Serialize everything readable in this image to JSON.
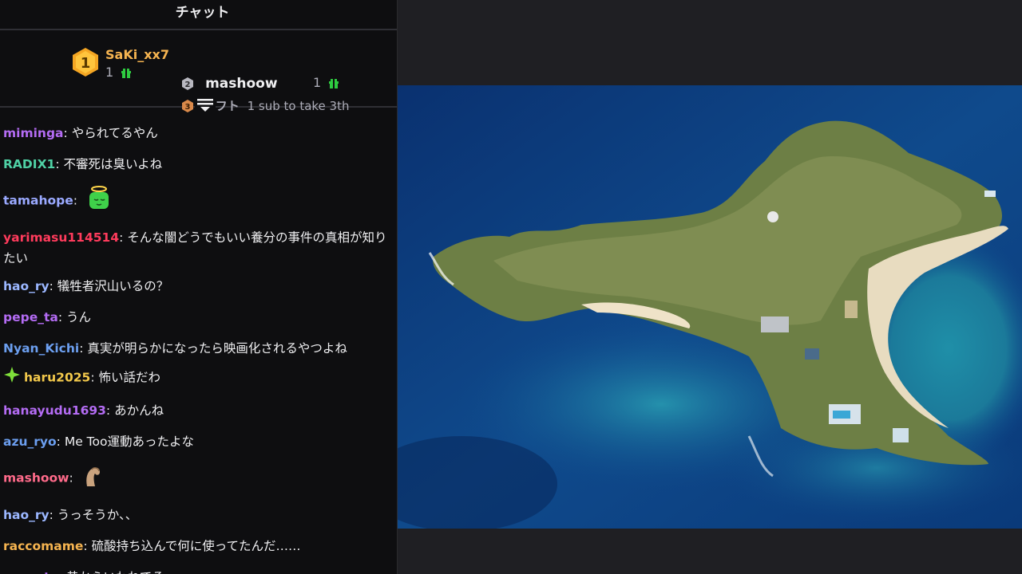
{
  "chat": {
    "title": "チャット",
    "leaderboard": {
      "first": {
        "rank": "1",
        "name": "SaKi_xx7",
        "count": "1"
      },
      "second": {
        "rank": "2",
        "name": "mashoow",
        "count": "1"
      },
      "third": {
        "rank": "3",
        "gift_label": "ギフト",
        "text": "1 sub to take 3th"
      }
    },
    "messages": [
      {
        "user": "miminga",
        "color": "#b46cf4",
        "text": "やられてるやん"
      },
      {
        "user": "RADIX1",
        "color": "#4fd1a5",
        "text": "不審死は臭いよね"
      },
      {
        "user": "tamahope",
        "color": "#9aa9ff",
        "text": "",
        "emote": "halo-face-emote"
      },
      {
        "user": "yarimasu114514",
        "color": "#ff3b5c",
        "text": "そんな闇どうでもいい養分の事件の真相が知りたい"
      },
      {
        "user": "hao_ry",
        "color": "#9bb7ff",
        "text": "犠牲者沢山いるの？"
      },
      {
        "user": "pepe_ta",
        "color": "#b46cf4",
        "text": "うん"
      },
      {
        "user": "Nyan_Kichi",
        "color": "#6c9ff0",
        "text": "真実が明らかになったら映画化されるやつよね"
      },
      {
        "user": "haru2025",
        "color": "#f2c84b",
        "text": "怖い話だわ",
        "badge": "sparkle-badge"
      },
      {
        "user": "hanayudu1693",
        "color": "#b46cf4",
        "text": "あかんね"
      },
      {
        "user": "azu_ryo",
        "color": "#6c9ff0",
        "text": "Me Too運動あったよな"
      },
      {
        "user": "mashoow",
        "color": "#ff6a8a",
        "text": "",
        "emote": "flex-arm-emote"
      },
      {
        "user": "hao_ry",
        "color": "#9bb7ff",
        "text": "うっそうか、、"
      },
      {
        "user": "raccomame",
        "color": "#f6b450",
        "text": "硫酸持ち込んで何に使ってたんだ……"
      },
      {
        "user": "pepe_ta",
        "color": "#b46cf4",
        "text": "昔からいわれてる"
      }
    ]
  },
  "colors": {
    "chat_bg": "#0e0e10",
    "gold": "#f6b450",
    "gift_green": "#00c853",
    "ocean_deep": "#0d3a78",
    "island_green": "#6d7f45"
  }
}
